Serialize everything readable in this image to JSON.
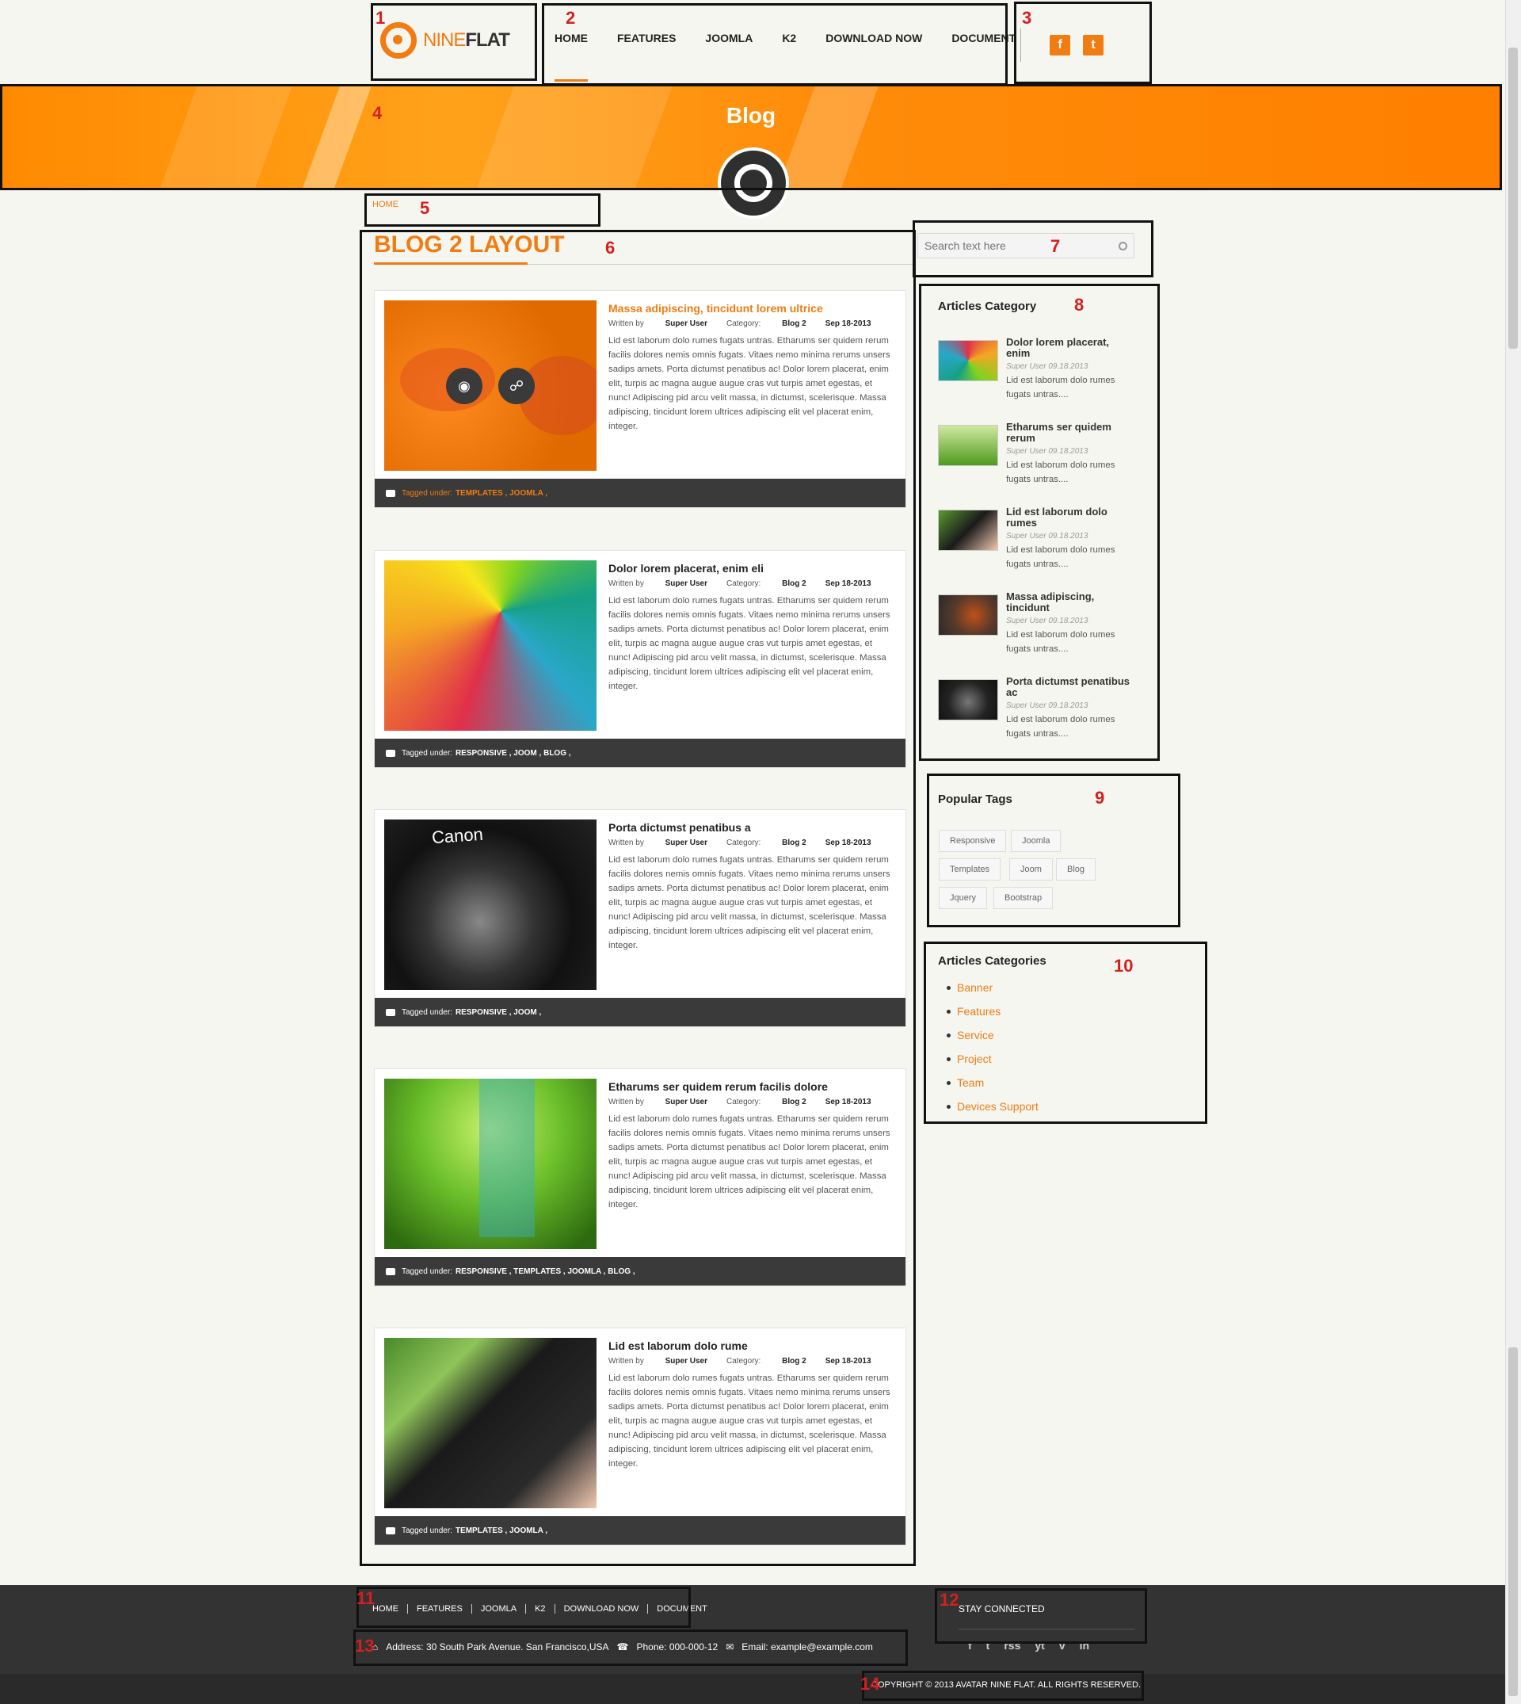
{
  "header": {
    "logo_a": "NINE",
    "logo_b": "FLAT",
    "nav": [
      "HOME",
      "FEATURES",
      "JOOMLA",
      "K2",
      "DOWNLOAD NOW",
      "DOCUMENT"
    ],
    "social": [
      "f",
      "t"
    ]
  },
  "banner": {
    "title": "Blog"
  },
  "breadcrumb": "HOME",
  "main": {
    "title": "BLOG 2 LAYOUT",
    "articles": [
      {
        "title": "Massa adipiscing, tincidunt lorem ultrice",
        "by_label": "Written by",
        "author": "Super User",
        "cat_label": "Category:",
        "category": "Blog 2",
        "date": "Sep 18-2013",
        "body": "Lid est laborum dolo rumes fugats untras. Etharums ser quidem rerum facilis dolores nemis omnis fugats. Vitaes nemo minima rerums unsers sadips amets. Porta dictumst penatibus ac! Dolor lorem placerat, enim elit, turpis ac magna augue augue cras vut turpis amet egestas, et nunc! Adipiscing pid arcu velit massa, in dictumst, scelerisque. Massa adipiscing, tincidunt lorem ultrices adipiscing elit vel placerat enim, integer.",
        "tag_label": "Tagged under:",
        "tags": "TEMPLATES , JOOMLA ,"
      },
      {
        "title": "Dolor lorem placerat, enim eli",
        "by_label": "Written by",
        "author": "Super User",
        "cat_label": "Category:",
        "category": "Blog 2",
        "date": "Sep 18-2013",
        "body": "Lid est laborum dolo rumes fugats untras. Etharums ser quidem rerum facilis dolores nemis omnis fugats. Vitaes nemo minima rerums unsers sadips amets. Porta dictumst penatibus ac! Dolor lorem placerat, enim elit, turpis ac magna augue augue cras vut turpis amet egestas, et nunc! Adipiscing pid arcu velit massa, in dictumst, scelerisque. Massa adipiscing, tincidunt lorem ultrices adipiscing elit vel placerat enim, integer.",
        "tag_label": "Tagged under:",
        "tags": "RESPONSIVE , JOOM , BLOG ,"
      },
      {
        "title": "Porta dictumst penatibus a",
        "by_label": "Written by",
        "author": "Super User",
        "cat_label": "Category:",
        "category": "Blog 2",
        "date": "Sep 18-2013",
        "body": "Lid est laborum dolo rumes fugats untras. Etharums ser quidem rerum facilis dolores nemis omnis fugats. Vitaes nemo minima rerums unsers sadips amets. Porta dictumst penatibus ac! Dolor lorem placerat, enim elit, turpis ac magna augue augue cras vut turpis amet egestas, et nunc! Adipiscing pid arcu velit massa, in dictumst, scelerisque. Massa adipiscing, tincidunt lorem ultrices adipiscing elit vel placerat enim, integer.",
        "tag_label": "Tagged under:",
        "tags": "RESPONSIVE , JOOM ,"
      },
      {
        "title": "Etharums ser quidem rerum facilis dolore",
        "by_label": "Written by",
        "author": "Super User",
        "cat_label": "Category:",
        "category": "Blog 2",
        "date": "Sep 18-2013",
        "body": "Lid est laborum dolo rumes fugats untras. Etharums ser quidem rerum facilis dolores nemis omnis fugats. Vitaes nemo minima rerums unsers sadips amets. Porta dictumst penatibus ac! Dolor lorem placerat, enim elit, turpis ac magna augue augue cras vut turpis amet egestas, et nunc! Adipiscing pid arcu velit massa, in dictumst, scelerisque. Massa adipiscing, tincidunt lorem ultrices adipiscing elit vel placerat enim, integer.",
        "tag_label": "Tagged under:",
        "tags": "RESPONSIVE , TEMPLATES , JOOMLA , BLOG ,"
      },
      {
        "title": "Lid est laborum dolo rume",
        "by_label": "Written by",
        "author": "Super User",
        "cat_label": "Category:",
        "category": "Blog 2",
        "date": "Sep 18-2013",
        "body": "Lid est laborum dolo rumes fugats untras. Etharums ser quidem rerum facilis dolores nemis omnis fugats. Vitaes nemo minima rerums unsers sadips amets. Porta dictumst penatibus ac! Dolor lorem placerat, enim elit, turpis ac magna augue augue cras vut turpis amet egestas, et nunc! Adipiscing pid arcu velit massa, in dictumst, scelerisque. Massa adipiscing, tincidunt lorem ultrices adipiscing elit vel placerat enim, integer.",
        "tag_label": "Tagged under:",
        "tags": "TEMPLATES , JOOMLA ,"
      }
    ]
  },
  "sidebar": {
    "search_placeholder": "Search text here",
    "articles_category": {
      "title": "Articles Category",
      "items": [
        {
          "title": "Dolor lorem placerat, enim",
          "meta": "Super User 09.18.2013",
          "desc": "Lid est laborum dolo rumes fugats untras...."
        },
        {
          "title": "Etharums ser quidem rerum",
          "meta": "Super User 09.18.2013",
          "desc": "Lid est laborum dolo rumes fugats untras...."
        },
        {
          "title": "Lid est laborum dolo rumes",
          "meta": "Super User 09.18.2013",
          "desc": "Lid est laborum dolo rumes fugats untras...."
        },
        {
          "title": "Massa adipiscing, tincidunt",
          "meta": "Super User 09.18.2013",
          "desc": "Lid est laborum dolo rumes fugats untras...."
        },
        {
          "title": "Porta dictumst penatibus ac",
          "meta": "Super User 09.18.2013",
          "desc": "Lid est laborum dolo rumes fugats untras...."
        }
      ]
    },
    "popular_tags": {
      "title": "Popular Tags",
      "tags": [
        "Responsive",
        "Joomla",
        "Templates",
        "Joom",
        "Blog",
        "Jquery",
        "Bootstrap"
      ]
    },
    "articles_categories": {
      "title": "Articles Categories",
      "items": [
        "Banner",
        "Features",
        "Service",
        "Project",
        "Team",
        "Devices Support"
      ]
    }
  },
  "footer": {
    "nav": [
      "HOME",
      "FEATURES",
      "JOOMLA",
      "K2",
      "DOWNLOAD NOW",
      "DOCUMENT"
    ],
    "address": "Address: 30 South Park Avenue. San Francisco,USA",
    "phone": "Phone: 000-000-12",
    "email": "Email: example@example.com",
    "stay": "STAY CONNECTED",
    "socials": [
      "f",
      "t",
      "rss",
      "yt",
      "v",
      "in"
    ],
    "copyright": "COPYRIGHT © 2013 AVATAR NINE FLAT. ALL RIGHTS RESERVED."
  },
  "annotations": [
    "1",
    "2",
    "3",
    "4",
    "5",
    "6",
    "7",
    "8",
    "9",
    "10",
    "11",
    "12",
    "13",
    "14"
  ],
  "colors": {
    "accent": "#f07c12",
    "footer": "#333333",
    "banner": "#ff8a00"
  }
}
